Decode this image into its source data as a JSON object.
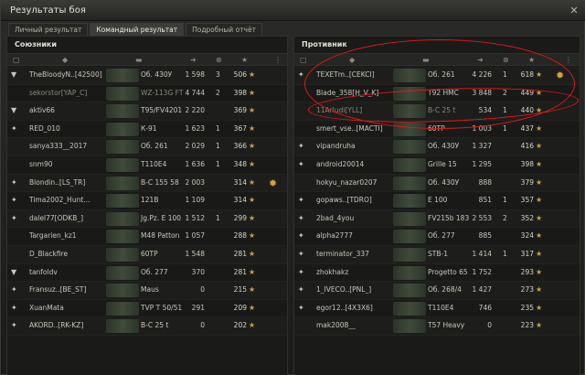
{
  "window": {
    "title": "Результаты боя",
    "close_glyph": "✕"
  },
  "tabs": [
    {
      "label": "Личный результат",
      "active": false
    },
    {
      "label": "Командный результат",
      "active": true
    },
    {
      "label": "Подробный отчёт",
      "active": false
    }
  ],
  "left": {
    "title": "Союзники",
    "rows": [
      {
        "badge": "shield",
        "name": "TheBloodyN..[42500]",
        "tank": "Об. 430У",
        "damage": "1 598",
        "kills": "3",
        "xp": "506",
        "dim": false,
        "medal": false
      },
      {
        "badge": "",
        "name": "sekorstor[YAP_C]",
        "tank": "WZ-113G FT",
        "damage": "4 744",
        "kills": "2",
        "xp": "398",
        "dim": true,
        "medal": false
      },
      {
        "badge": "shield",
        "name": "aktiv66",
        "tank": "T95/FV4201",
        "damage": "2 220",
        "kills": "",
        "xp": "369",
        "dim": false,
        "medal": false
      },
      {
        "badge": "rank",
        "name": "RED_010",
        "tank": "К-91",
        "damage": "1 623",
        "kills": "1",
        "xp": "367",
        "dim": false,
        "medal": false
      },
      {
        "badge": "",
        "name": "sanya333__2017",
        "tank": "Об. 261",
        "damage": "2 029",
        "kills": "1",
        "xp": "366",
        "dim": false,
        "medal": false
      },
      {
        "badge": "",
        "name": "snm90",
        "tank": "T110E4",
        "damage": "1 636",
        "kills": "1",
        "xp": "348",
        "dim": false,
        "medal": false
      },
      {
        "badge": "rank",
        "name": "Blondin..[LS_TR]",
        "tank": "В-С 155 58",
        "damage": "2 003",
        "kills": "",
        "xp": "314",
        "dim": false,
        "medal": true
      },
      {
        "badge": "rank",
        "name": "Tima2002_Hunt...",
        "tank": "121B",
        "damage": "1 109",
        "kills": "",
        "xp": "314",
        "dim": false,
        "medal": false
      },
      {
        "badge": "rank",
        "name": "dalel77[ODKB_]",
        "tank": "Jg.Pz. E 100",
        "damage": "1 512",
        "kills": "1",
        "xp": "299",
        "dim": false,
        "medal": false
      },
      {
        "badge": "",
        "name": "Targarien_kz1",
        "tank": "M48 Patton",
        "damage": "1 057",
        "kills": "",
        "xp": "288",
        "dim": false,
        "medal": false
      },
      {
        "badge": "",
        "name": "D_Blackfire",
        "tank": "60TP",
        "damage": "1 548",
        "kills": "",
        "xp": "281",
        "dim": false,
        "medal": false
      },
      {
        "badge": "shield",
        "name": "tanfoldv",
        "tank": "Об. 277",
        "damage": "370",
        "kills": "",
        "xp": "281",
        "dim": false,
        "medal": false
      },
      {
        "badge": "rank",
        "name": "Fransuz..[BE_ST]",
        "tank": "Maus",
        "damage": "0",
        "kills": "",
        "xp": "215",
        "dim": false,
        "medal": false
      },
      {
        "badge": "rank",
        "name": "XuanMata",
        "tank": "TVP T 50/51",
        "damage": "291",
        "kills": "",
        "xp": "209",
        "dim": false,
        "medal": false
      },
      {
        "badge": "rank",
        "name": "AKORD..[RK-KZ]",
        "tank": "В-С 25 t",
        "damage": "0",
        "kills": "",
        "xp": "202",
        "dim": false,
        "medal": false
      }
    ]
  },
  "right": {
    "title": "Противник",
    "rows": [
      {
        "badge": "rank",
        "name": "TEXETm..[CEKCI]",
        "tank": "Об. 261",
        "damage": "4 226",
        "kills": "1",
        "xp": "618",
        "dim": false,
        "medal": true
      },
      {
        "badge": "",
        "name": "Blade_358[H_V_K]",
        "tank": "T92 HMC",
        "damage": "3 848",
        "kills": "2",
        "xp": "449",
        "dim": false,
        "medal": false
      },
      {
        "badge": "",
        "name": "11Arludi[YLL]",
        "tank": "В-С 25 t",
        "damage": "534",
        "kills": "1",
        "xp": "440",
        "dim": true,
        "medal": false
      },
      {
        "badge": "",
        "name": "smert_vse..[MACTI]",
        "tank": "60TP",
        "damage": "1 003",
        "kills": "1",
        "xp": "437",
        "dim": false,
        "medal": false
      },
      {
        "badge": "rank",
        "name": "vipandruha",
        "tank": "Об. 430У",
        "damage": "1 327",
        "kills": "",
        "xp": "416",
        "dim": false,
        "medal": false
      },
      {
        "badge": "rank",
        "name": "android20014",
        "tank": "Grille 15",
        "damage": "1 295",
        "kills": "",
        "xp": "398",
        "dim": false,
        "medal": false
      },
      {
        "badge": "",
        "name": "hokyu_nazar0207",
        "tank": "Об. 430У",
        "damage": "888",
        "kills": "",
        "xp": "379",
        "dim": false,
        "medal": false
      },
      {
        "badge": "rank",
        "name": "gopaws..[TDRO]",
        "tank": "E 100",
        "damage": "851",
        "kills": "1",
        "xp": "357",
        "dim": false,
        "medal": false
      },
      {
        "badge": "rank",
        "name": "2bad_4you",
        "tank": "FV215b 183",
        "damage": "2 553",
        "kills": "2",
        "xp": "352",
        "dim": false,
        "medal": false
      },
      {
        "badge": "rank",
        "name": "alpha2777",
        "tank": "Об. 277",
        "damage": "885",
        "kills": "",
        "xp": "324",
        "dim": false,
        "medal": false
      },
      {
        "badge": "rank",
        "name": "terminator_337",
        "tank": "STB-1",
        "damage": "1 414",
        "kills": "1",
        "xp": "317",
        "dim": false,
        "medal": false
      },
      {
        "badge": "rank",
        "name": "zhokhakz",
        "tank": "Progetto 65",
        "damage": "1 752",
        "kills": "",
        "xp": "293",
        "dim": false,
        "medal": false
      },
      {
        "badge": "rank",
        "name": "1_IVECO..[PNL_]",
        "tank": "Об. 268/4",
        "damage": "1 427",
        "kills": "",
        "xp": "273",
        "dim": false,
        "medal": false
      },
      {
        "badge": "rank",
        "name": "egor12..[4X3X6]",
        "tank": "T110E4",
        "damage": "746",
        "kills": "",
        "xp": "235",
        "dim": false,
        "medal": false
      },
      {
        "badge": "",
        "name": "mak2008__",
        "tank": "T57 Heavy",
        "damage": "0",
        "kills": "",
        "xp": "223",
        "dim": false,
        "medal": false
      }
    ]
  },
  "icons": {
    "star": "★",
    "medal": "✹",
    "shield": "▼",
    "rank": "✦"
  },
  "colors": {
    "highlight_oval": "#e01818"
  }
}
